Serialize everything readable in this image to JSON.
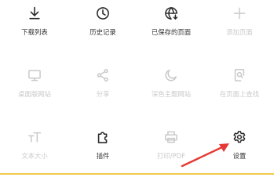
{
  "menu": {
    "items": [
      {
        "label": "下载列表",
        "icon": "download-icon",
        "enabled": true
      },
      {
        "label": "历史记录",
        "icon": "clock-icon",
        "enabled": true
      },
      {
        "label": "已保存的页面",
        "icon": "globe-download-icon",
        "enabled": true
      },
      {
        "label": "添加页面",
        "icon": "plus-icon",
        "enabled": false
      },
      {
        "label": "桌面版网站",
        "icon": "monitor-icon",
        "enabled": false
      },
      {
        "label": "分享",
        "icon": "share-icon",
        "enabled": false
      },
      {
        "label": "深色主题网站",
        "icon": "moon-icon",
        "enabled": false
      },
      {
        "label": "在页面上查找",
        "icon": "find-in-page-icon",
        "enabled": false
      },
      {
        "label": "文本大小",
        "icon": "text-size-icon",
        "enabled": false
      },
      {
        "label": "插件",
        "icon": "puzzle-icon",
        "enabled": true
      },
      {
        "label": "打印/PDF",
        "icon": "printer-icon",
        "enabled": false
      },
      {
        "label": "设置",
        "icon": "gear-icon",
        "enabled": true
      }
    ]
  },
  "colors": {
    "enabled_text": "#333333",
    "disabled_text": "#c9c9c9",
    "annotation_arrow": "#e53935",
    "bottom_accent": "#f2c94c"
  }
}
